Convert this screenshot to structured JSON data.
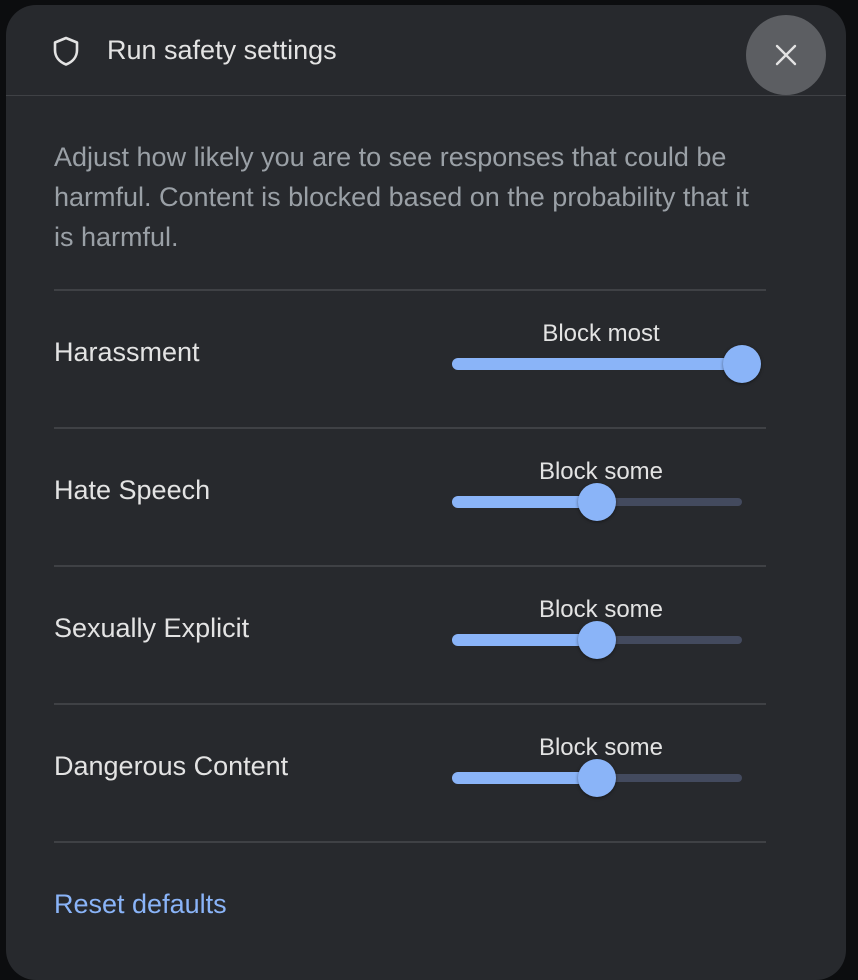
{
  "dialog": {
    "title": "Run safety settings",
    "icon": "shield-icon",
    "close_icon": "close-icon",
    "description": "Adjust how likely you are to see responses that could be harmful. Content is blocked based on the probability that it is harmful.",
    "reset_label": "Reset defaults",
    "accent_color": "#8ab4f8"
  },
  "categories": [
    {
      "label": "Harassment",
      "level": "Block most",
      "value_fraction": 1.0
    },
    {
      "label": "Hate Speech",
      "level": "Block some",
      "value_fraction": 0.5
    },
    {
      "label": "Sexually Explicit",
      "level": "Block some",
      "value_fraction": 0.5
    },
    {
      "label": "Dangerous Content",
      "level": "Block some",
      "value_fraction": 0.5
    }
  ]
}
